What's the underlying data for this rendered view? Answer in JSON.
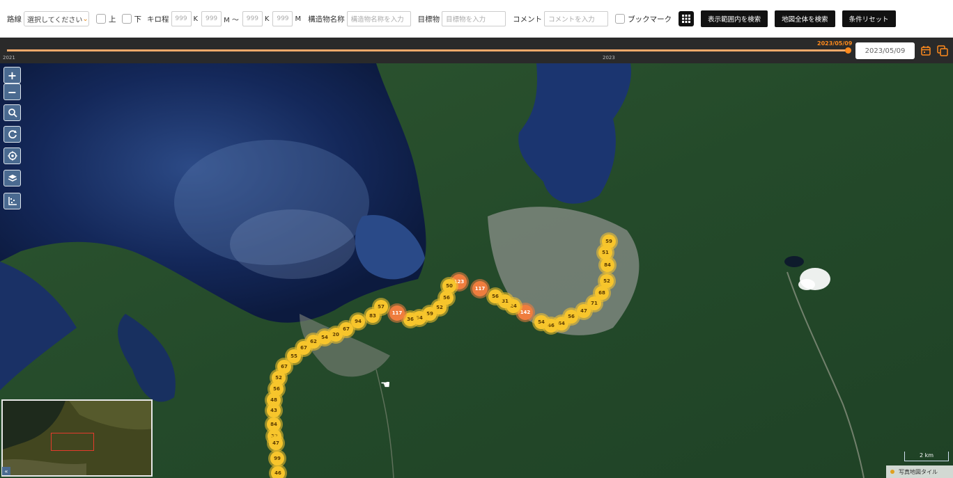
{
  "filters": {
    "route_label": "路線",
    "route_select": "選択してください",
    "up_label": "上",
    "down_label": "下",
    "km_label": "キロ程",
    "km_from_k": "999",
    "km_from_m": "999",
    "km_to_k": "999",
    "km_to_m": "999",
    "k_unit": "K",
    "m_unit_tilde": "M ～",
    "m_unit": "M",
    "structure_label": "構造物名称",
    "structure_placeholder": "構造物名称を入力",
    "landmark_label": "目標物",
    "landmark_placeholder": "目標物を入力",
    "comment_label": "コメント",
    "comment_placeholder": "コメントを入力",
    "bookmark_label": "ブックマーク",
    "search_view_button": "表示範囲内を検索",
    "search_all_button": "地図全体を検索",
    "reset_button": "条件リセット"
  },
  "timeline": {
    "current_date_label": "2023/05/09",
    "tick_2021": "2021",
    "tick_2023": "2023",
    "date_input_value": "2023/05/09",
    "position_fraction": 0.996
  },
  "map": {
    "controls": [
      "zoom-in",
      "zoom-out",
      "search",
      "refresh",
      "locate",
      "layers",
      "legend"
    ],
    "zoom_in_symbol": "+",
    "zoom_out_symbol": "−",
    "scale_label": "2 km",
    "attribution": "写真地図タイル",
    "collapse_symbol": "«",
    "clusters_yellow_color": "#f7c52c",
    "clusters_orange_color": "#ef7d3e"
  },
  "clusters": [
    {
      "label": "59",
      "kind": "y"
    },
    {
      "label": "51",
      "kind": "y"
    },
    {
      "label": "84",
      "kind": "y"
    },
    {
      "label": "52",
      "kind": "y"
    },
    {
      "label": "68",
      "kind": "y"
    },
    {
      "label": "71",
      "kind": "y"
    },
    {
      "label": "47",
      "kind": "y"
    },
    {
      "label": "56",
      "kind": "y"
    },
    {
      "label": "64",
      "kind": "y"
    },
    {
      "label": "46",
      "kind": "y"
    },
    {
      "label": "54",
      "kind": "y"
    },
    {
      "label": "142",
      "kind": "o"
    },
    {
      "label": "24",
      "kind": "y"
    },
    {
      "label": "31",
      "kind": "y"
    },
    {
      "label": "56",
      "kind": "y"
    },
    {
      "label": "117",
      "kind": "o"
    },
    {
      "label": "123",
      "kind": "o"
    },
    {
      "label": "50",
      "kind": "y"
    },
    {
      "label": "56",
      "kind": "y"
    },
    {
      "label": "52",
      "kind": "y"
    },
    {
      "label": "59",
      "kind": "y"
    },
    {
      "label": "54",
      "kind": "y"
    },
    {
      "label": "36",
      "kind": "y"
    },
    {
      "label": "117",
      "kind": "o"
    },
    {
      "label": "57",
      "kind": "y"
    },
    {
      "label": "83",
      "kind": "y"
    },
    {
      "label": "94",
      "kind": "y"
    },
    {
      "label": "67",
      "kind": "y"
    },
    {
      "label": "20",
      "kind": "y"
    },
    {
      "label": "54",
      "kind": "y"
    },
    {
      "label": "62",
      "kind": "y"
    },
    {
      "label": "67",
      "kind": "y"
    },
    {
      "label": "55",
      "kind": "y"
    },
    {
      "label": "67",
      "kind": "y"
    },
    {
      "label": "52",
      "kind": "y"
    },
    {
      "label": "56",
      "kind": "y"
    },
    {
      "label": "48",
      "kind": "y"
    },
    {
      "label": "43",
      "kind": "y"
    },
    {
      "label": "84",
      "kind": "y"
    },
    {
      "label": "32",
      "kind": "y"
    },
    {
      "label": "47",
      "kind": "y"
    },
    {
      "label": "99",
      "kind": "y"
    },
    {
      "label": "46",
      "kind": "y"
    }
  ]
}
